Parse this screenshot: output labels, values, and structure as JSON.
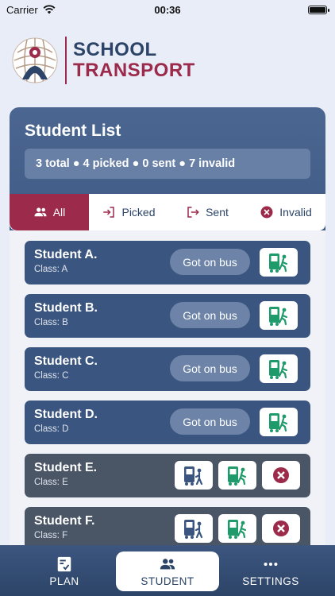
{
  "status_bar": {
    "carrier": "Carrier",
    "time": "00:36"
  },
  "logo": {
    "line1": "SCHOOL",
    "line2": "TRANSPORT"
  },
  "panel": {
    "title": "Student List",
    "summary": "3 total ● 4 picked ● 0 sent ● 7 invalid"
  },
  "tabs": [
    {
      "label": "All",
      "icon": "users-icon",
      "active": true
    },
    {
      "label": "Picked",
      "icon": "login-icon"
    },
    {
      "label": "Sent",
      "icon": "logout-icon"
    },
    {
      "label": "Invalid",
      "icon": "x-circle-icon"
    }
  ],
  "students": [
    {
      "name": "Student A.",
      "class": "Class: A",
      "action": "Got on bus"
    },
    {
      "name": "Student B.",
      "class": "Class: B",
      "action": "Got on bus"
    },
    {
      "name": "Student C.",
      "class": "Class: C",
      "action": "Got on bus"
    },
    {
      "name": "Student D.",
      "class": "Class: D",
      "action": "Got on bus"
    },
    {
      "name": "Student E.",
      "class": "Class: E"
    },
    {
      "name": "Student F.",
      "class": "Class: F"
    }
  ],
  "nav": [
    {
      "label": "PLAN",
      "icon": "checklist-icon"
    },
    {
      "label": "STUDENT",
      "icon": "users-icon",
      "active": true
    },
    {
      "label": "SETTINGS",
      "icon": "more-horizontal-icon"
    }
  ],
  "colors": {
    "brand_blue": "#2b4468",
    "brand_red": "#9c2a4a",
    "card_blue": "#3a557f",
    "card_gray": "#4a5566",
    "green": "#1f9a6a"
  }
}
